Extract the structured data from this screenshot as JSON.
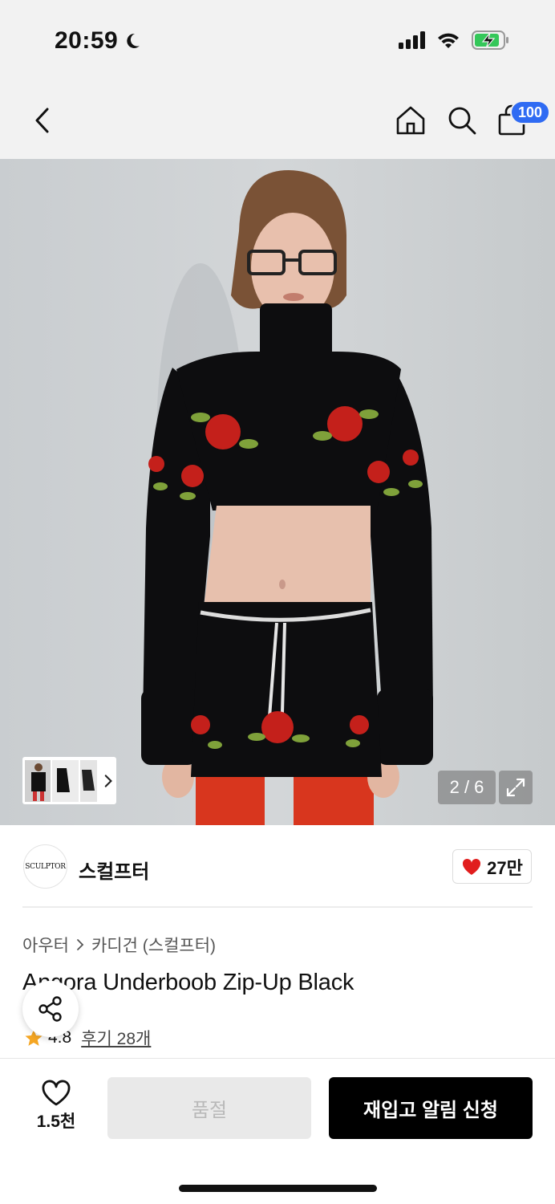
{
  "status_bar": {
    "time": "20:59"
  },
  "nav": {
    "cart_count": "100"
  },
  "gallery": {
    "counter": "2 / 6"
  },
  "brand": {
    "logo_text": "SCULPTOR",
    "name": "스컬프터",
    "likes": "27만"
  },
  "breadcrumb": {
    "level1": "아우터",
    "level2": "카디건 (스컬프터)"
  },
  "product": {
    "title": "Angora Underboob Zip-Up Black",
    "rating": "4.8",
    "reviews": "후기 28개"
  },
  "bottom_bar": {
    "wish_count": "1.5천",
    "soldout_label": "품절",
    "restock_label": "재입고 알림 신청"
  },
  "colors": {
    "accent_blue": "#2f6bf3",
    "heart_red": "#e11d1d",
    "star": "#f5a623",
    "battery_green": "#34c759"
  }
}
